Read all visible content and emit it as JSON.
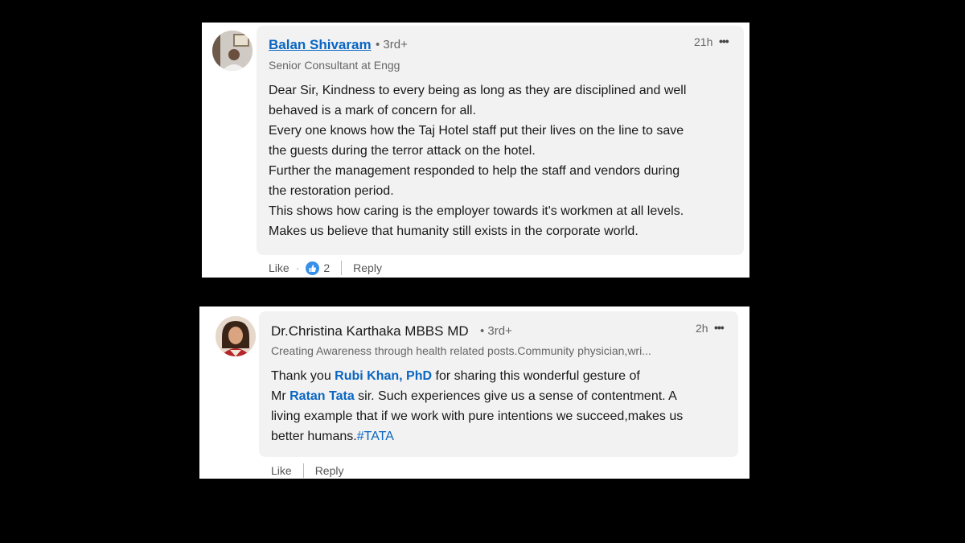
{
  "comments": [
    {
      "author": "Balan Shivaram",
      "degree": "• 3rd+",
      "headline": "Senior Consultant at Engg",
      "time": "21h",
      "more": "•••",
      "lines": [
        "Dear Sir, Kindness to every being as long as they are disciplined and well",
        "behaved is a mark of concern for all.",
        "Every one knows how the Taj Hotel staff put their lives on the line to save",
        "the guests during the terror attack on the hotel.",
        "Further the management responded to help the staff and vendors during",
        "the restoration period.",
        "This shows how caring is the employer towards it's workmen at all levels.",
        "Makes us believe that humanity still exists in the corporate world."
      ],
      "like_label": "Like",
      "dot": "·",
      "reaction_count": "2",
      "reply_label": "Reply"
    },
    {
      "author": "Dr.Christina Karthaka MBBS MD",
      "degree": "• 3rd+",
      "headline": "Creating Awareness through health related posts.Community physician,wri...",
      "time": "2h",
      "more": "•••",
      "line1_pre": "Thank you ",
      "mention1": "Rubi Khan, PhD",
      "line1_post": " for sharing this wonderful gesture of",
      "line2_pre": "Mr ",
      "mention2": "Ratan Tata",
      "line2_post": " sir. Such experiences give us a sense of contentment. A",
      "line3": "living example that if we work with pure intentions we succeed,makes us",
      "line4_pre": "better humans.",
      "hashtag": "#TATA",
      "like_label": "Like",
      "reply_label": "Reply"
    }
  ],
  "colors": {
    "link": "#0a66c2",
    "bubble": "#f2f2f2",
    "background": "#000000",
    "reaction": "#378fe9"
  },
  "icons": [
    "avatar-photo",
    "more-options-icon",
    "like-reaction-icon"
  ]
}
